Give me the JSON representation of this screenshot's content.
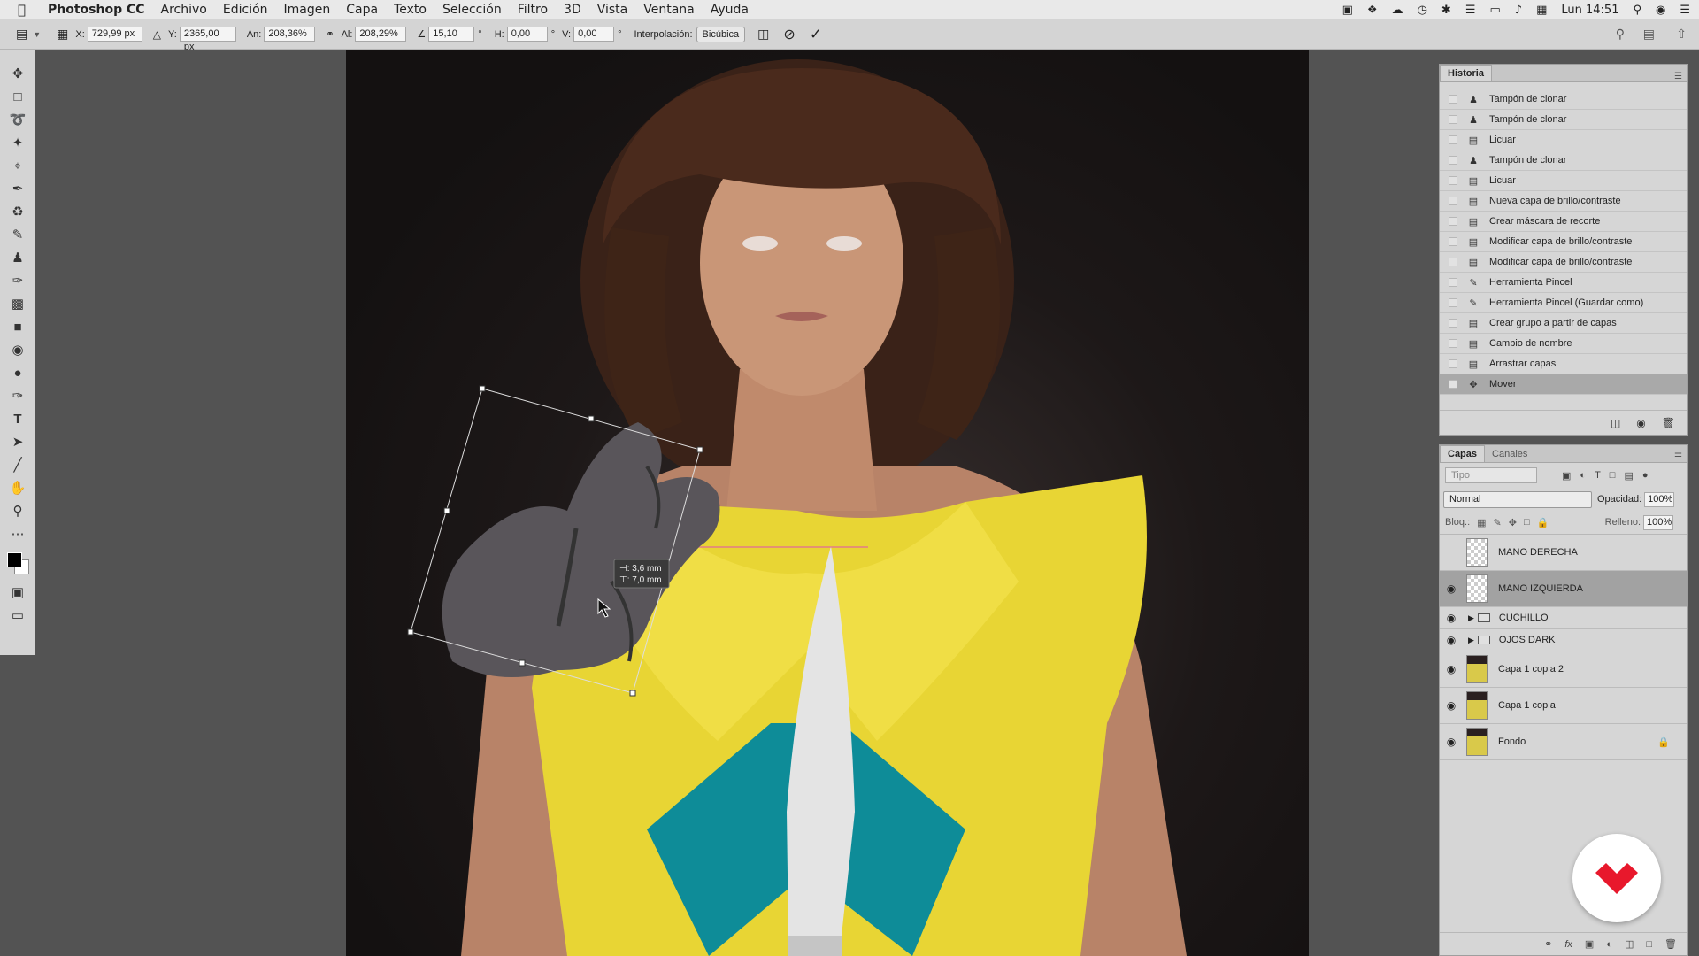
{
  "menubar": {
    "apple": "",
    "app": "Photoshop CC",
    "items": [
      "Archivo",
      "Edición",
      "Imagen",
      "Capa",
      "Texto",
      "Selección",
      "Filtro",
      "3D",
      "Vista",
      "Ventana",
      "Ayuda"
    ],
    "clock": "Lun 14:51"
  },
  "options": {
    "x_label": "X:",
    "x_value": "729,99 px",
    "y_label": "Y:",
    "y_value": "2365,00 px",
    "w_label": "An:",
    "w_value": "208,36%",
    "h_label": "Al:",
    "h_value": "208,29%",
    "angle_value": "15,10",
    "hskew_label": "H:",
    "hskew_value": "0,00",
    "vskew_label": "V:",
    "vskew_value": "0,00",
    "interp_label": "Interpolación:",
    "interp_value": "Bicúbica"
  },
  "transform_tooltip": {
    "line1": "⊣: 3,6 mm",
    "line2": "⊤: 7,0 mm"
  },
  "history": {
    "tab": "Historia",
    "items": [
      {
        "icon": "stamp-icon",
        "label": "Tampón de clonar"
      },
      {
        "icon": "stamp-icon",
        "label": "Tampón de clonar"
      },
      {
        "icon": "document-icon",
        "label": "Licuar"
      },
      {
        "icon": "stamp-icon",
        "label": "Tampón de clonar"
      },
      {
        "icon": "document-icon",
        "label": "Licuar"
      },
      {
        "icon": "document-icon",
        "label": "Nueva capa de brillo/contraste"
      },
      {
        "icon": "document-icon",
        "label": "Crear máscara de recorte"
      },
      {
        "icon": "document-icon",
        "label": "Modificar capa de brillo/contraste"
      },
      {
        "icon": "document-icon",
        "label": "Modificar capa de brillo/contraste"
      },
      {
        "icon": "brush-icon",
        "label": "Herramienta Pincel"
      },
      {
        "icon": "brush-icon",
        "label": "Herramienta Pincel (Guardar como)"
      },
      {
        "icon": "document-icon",
        "label": "Crear grupo a partir de capas"
      },
      {
        "icon": "document-icon",
        "label": "Cambio de nombre"
      },
      {
        "icon": "document-icon",
        "label": "Arrastrar capas"
      },
      {
        "icon": "move-icon",
        "label": "Mover"
      }
    ]
  },
  "layers": {
    "tabs": [
      "Capas",
      "Canales"
    ],
    "filter_placeholder": "Tipo",
    "blend_mode": "Normal",
    "opacity_label": "Opacidad:",
    "opacity_value": "100%",
    "lock_label": "Bloq.:",
    "fill_label": "Relleno:",
    "fill_value": "100%",
    "items": [
      {
        "name": "MANO DERECHA",
        "visible": false,
        "kind": "layer"
      },
      {
        "name": "MANO IZQUIERDA",
        "visible": true,
        "kind": "layer",
        "selected": true
      },
      {
        "name": "CUCHILLO",
        "visible": true,
        "kind": "group"
      },
      {
        "name": "OJOS DARK",
        "visible": true,
        "kind": "group"
      },
      {
        "name": "Capa 1 copia 2",
        "visible": true,
        "kind": "image"
      },
      {
        "name": "Capa 1 copia",
        "visible": true,
        "kind": "image"
      },
      {
        "name": "Fondo",
        "visible": true,
        "kind": "image",
        "locked": true
      }
    ]
  },
  "colors": {
    "accent_logo": "#e8182c",
    "selected_row": "#a2a2a2"
  }
}
